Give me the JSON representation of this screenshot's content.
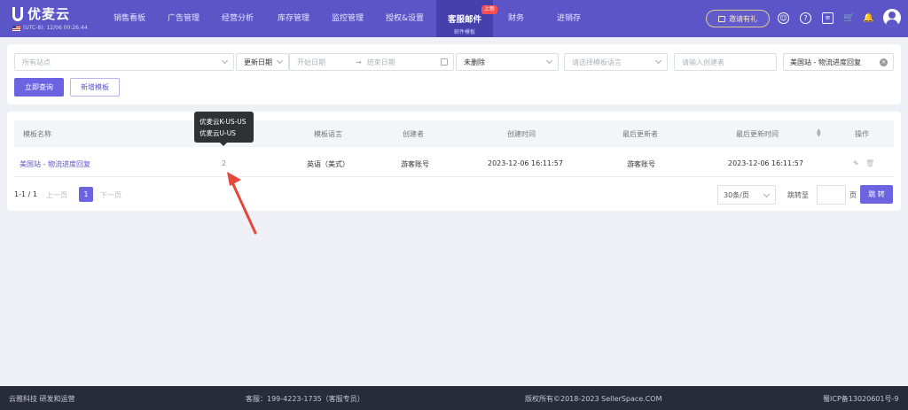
{
  "brand": {
    "name": "优麦云",
    "timezone": "(UTC-8): 12/06 00:26:44"
  },
  "nav": {
    "items": [
      "销售看板",
      "广告管理",
      "经营分析",
      "库存管理",
      "监控管理",
      "授权&设置"
    ],
    "active": {
      "label": "客服邮件",
      "sub": "邮件模板",
      "badge": "上新"
    },
    "after": [
      "财务",
      "进销存"
    ],
    "invite": "邀请有礼"
  },
  "filters": {
    "site_placeholder": "所有站点",
    "date_type": "更新日期",
    "start_placeholder": "开始日期",
    "arrow": "→",
    "end_placeholder": "结束日期",
    "status": "未删除",
    "lang_placeholder": "请选择模板语言",
    "creator_placeholder": "请输入创建者",
    "template_chip": "美国站 - 物流进度回复",
    "query_button": "立即查询",
    "add_button": "新增模板"
  },
  "table": {
    "headers": [
      "模板名称",
      "模板语言",
      "创建者",
      "创建时间",
      "最后更新者",
      "最后更新时间",
      "操作"
    ],
    "rows": [
      {
        "name": "美国站 - 物流进度回复",
        "count": "2",
        "language": "英语（美式）",
        "creator": "游客账号",
        "created": "2023-12-06 16:11:57",
        "updater": "游客账号",
        "updated": "2023-12-06 16:11:57"
      }
    ],
    "tooltip": [
      "优麦云K-US-US",
      "优麦云U-US"
    ]
  },
  "pagination": {
    "range": "1-1 / 1",
    "prev": "上一页",
    "page": "1",
    "next": "下一页",
    "page_size": "30条/页",
    "jump_label": "跳转至",
    "page_unit": "页",
    "jump_button": "跳 转"
  },
  "footer": {
    "left": "云雅科技 研发和运营",
    "service": "客服：199-4223-1735（客服专员）",
    "copyright": "版权所有©2018-2023 SellerSpace.COM",
    "icp": "蜀ICP备13020601号-9"
  },
  "colors": {
    "primary": "#5b55c8",
    "accent": "#6c63e0",
    "footer": "#282c3a",
    "badge": "#ff4d4f",
    "arrow": "#e8453c"
  },
  "icons": [
    "support-icon",
    "help-icon",
    "message-icon",
    "cart-icon",
    "bell-icon",
    "edit-icon",
    "delete-icon"
  ]
}
